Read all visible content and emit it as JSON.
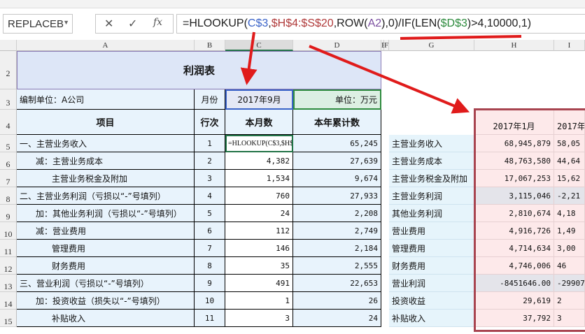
{
  "formula_bar": {
    "name_box": "REPLACEB",
    "cancel": "✕",
    "enter": "✓",
    "fx": "fx",
    "formula_parts": [
      [
        "=HLOOKUP(",
        "#222"
      ],
      [
        "C$3",
        "#3a63c8"
      ],
      [
        ",",
        "#222"
      ],
      [
        "$H$4:$S$20",
        "#b03a3a"
      ],
      [
        ",ROW(",
        "#222"
      ],
      [
        "A2",
        "#7b4fa0"
      ],
      [
        "),0)/IF(LEN(",
        "#222"
      ],
      [
        "$D$3",
        "#2e8b3e"
      ],
      [
        ")>4,10000,1)",
        "#222"
      ]
    ]
  },
  "columns": [
    "A",
    "B",
    "C",
    "D",
    "E",
    "F",
    "G",
    "H",
    "I"
  ],
  "rows": [
    "2",
    "3",
    "4",
    "5",
    "6",
    "7",
    "8",
    "9",
    "10",
    "11",
    "12",
    "13",
    "14",
    "15"
  ],
  "report": {
    "title": "利润表",
    "company": "编制单位：A公司",
    "month_label": "月份",
    "month_value": "2017年9月",
    "unit": "单位：万元",
    "headers": [
      "项目",
      "行次",
      "本月数",
      "本年累计数"
    ],
    "active_cell_text": "=HLOOKUP(C$3,$H$",
    "items": [
      {
        "name": "一、主营业务收入",
        "indent": 0,
        "no": "1",
        "month": "",
        "ytd": "65,245"
      },
      {
        "name": "减：主营业务成本",
        "indent": 1,
        "no": "2",
        "month": "4,382",
        "ytd": "27,639"
      },
      {
        "name": "主营业务税金及附加",
        "indent": 2,
        "no": "3",
        "month": "1,534",
        "ytd": "9,674"
      },
      {
        "name": "二、主营业务利润（亏损以“-”号填列）",
        "indent": 0,
        "no": "4",
        "month": "760",
        "ytd": "27,933"
      },
      {
        "name": "加：其他业务利润（亏损以“-”号填列）",
        "indent": 1,
        "no": "5",
        "month": "24",
        "ytd": "2,208"
      },
      {
        "name": "减：营业费用",
        "indent": 1,
        "no": "6",
        "month": "112",
        "ytd": "2,749"
      },
      {
        "name": "管理费用",
        "indent": 2,
        "no": "7",
        "month": "146",
        "ytd": "2,184"
      },
      {
        "name": "财务费用",
        "indent": 2,
        "no": "8",
        "month": "35",
        "ytd": "2,555"
      },
      {
        "name": "三、营业利润（亏损以“-”号填列）",
        "indent": 0,
        "no": "9",
        "month": "491",
        "ytd": "22,653"
      },
      {
        "name": "加：投资收益（损失以“-”号填列）",
        "indent": 1,
        "no": "10",
        "month": "1",
        "ytd": "26"
      },
      {
        "name": "补贴收入",
        "indent": 2,
        "no": "11",
        "month": "3",
        "ytd": "24"
      }
    ]
  },
  "source": {
    "headers": [
      "2017年1月",
      "2017年"
    ],
    "items": [
      {
        "name": "主营业务收入",
        "jan": "68,945,879",
        "feb": "58,05"
      },
      {
        "name": "主营业务成本",
        "jan": "48,763,580",
        "feb": "44,64"
      },
      {
        "name": "主营业务税金及附加",
        "jan": "17,067,253",
        "feb": "15,62"
      },
      {
        "name": "主营业务利润",
        "jan": "3,115,046",
        "feb": "-2,21",
        "gray": true
      },
      {
        "name": "其他业务利润",
        "jan": "2,810,674",
        "feb": "4,18"
      },
      {
        "name": "营业费用",
        "jan": "4,916,726",
        "feb": "1,49"
      },
      {
        "name": "管理费用",
        "jan": "4,714,634",
        "feb": "3,00"
      },
      {
        "name": "财务费用",
        "jan": "4,746,006",
        "feb": "46"
      },
      {
        "name": "营业利润",
        "jan": "-8451646.00",
        "feb": "-29907",
        "gray": true
      },
      {
        "name": "投资收益",
        "jan": "29,619",
        "feb": "2"
      },
      {
        "name": "补贴收入",
        "jan": "37,792",
        "feb": "3"
      }
    ]
  },
  "colors": {
    "annotation": "#e01b1b",
    "title_bg": "#dde6f7",
    "light_blue": "#e8f3fc",
    "pink": "#fde9ea",
    "border_red": "#a84450"
  }
}
